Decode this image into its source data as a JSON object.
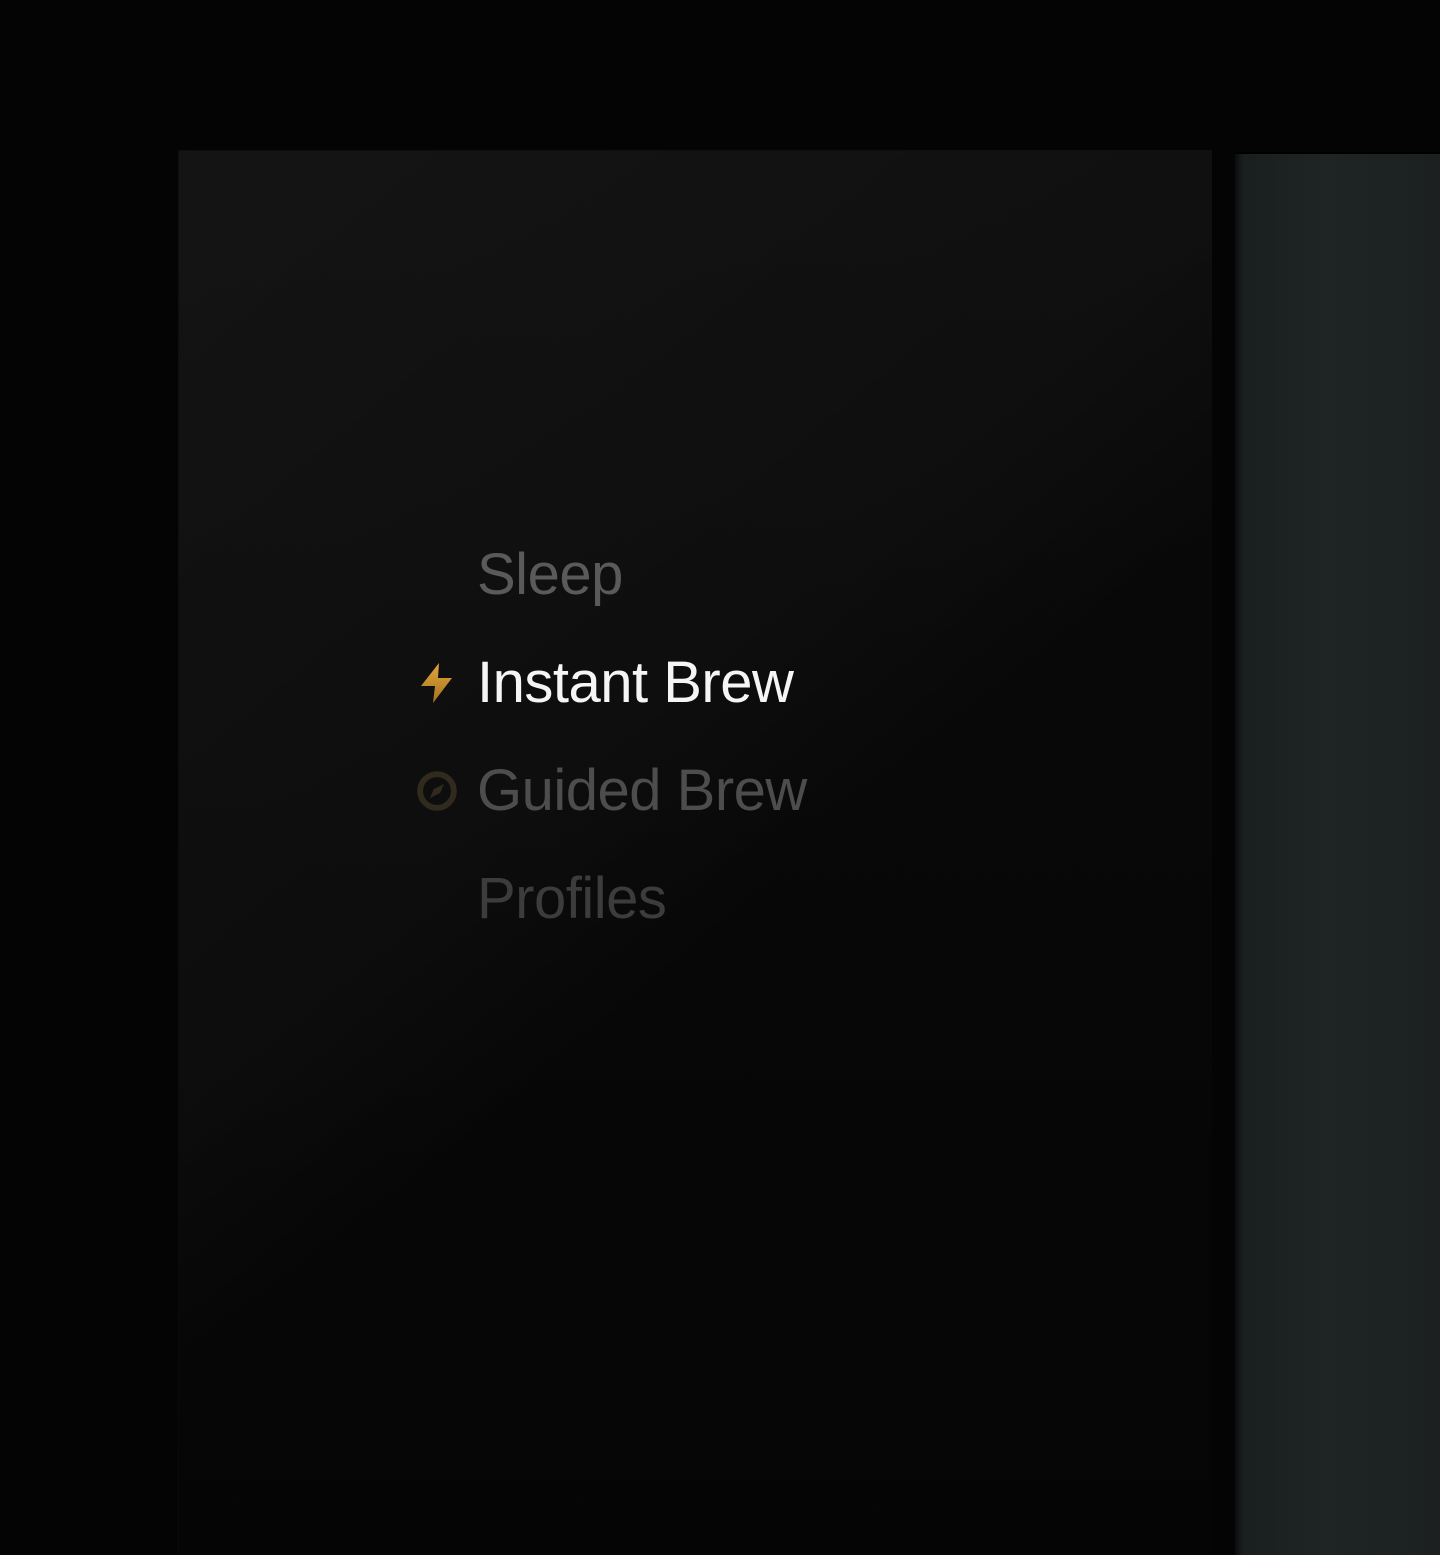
{
  "menu": {
    "items": [
      {
        "label": "Sleep",
        "icon": "none",
        "active": false,
        "dim": "dim-1"
      },
      {
        "label": "Instant Brew",
        "icon": "lightning-bolt",
        "active": true,
        "dim": ""
      },
      {
        "label": "Guided Brew",
        "icon": "compass",
        "active": false,
        "dim": "dim-2"
      },
      {
        "label": "Profiles",
        "icon": "none",
        "active": false,
        "dim": "dim-3"
      }
    ]
  },
  "colors": {
    "accent_gold_top": "#e0a63c",
    "accent_gold_bottom": "#b07a28"
  }
}
